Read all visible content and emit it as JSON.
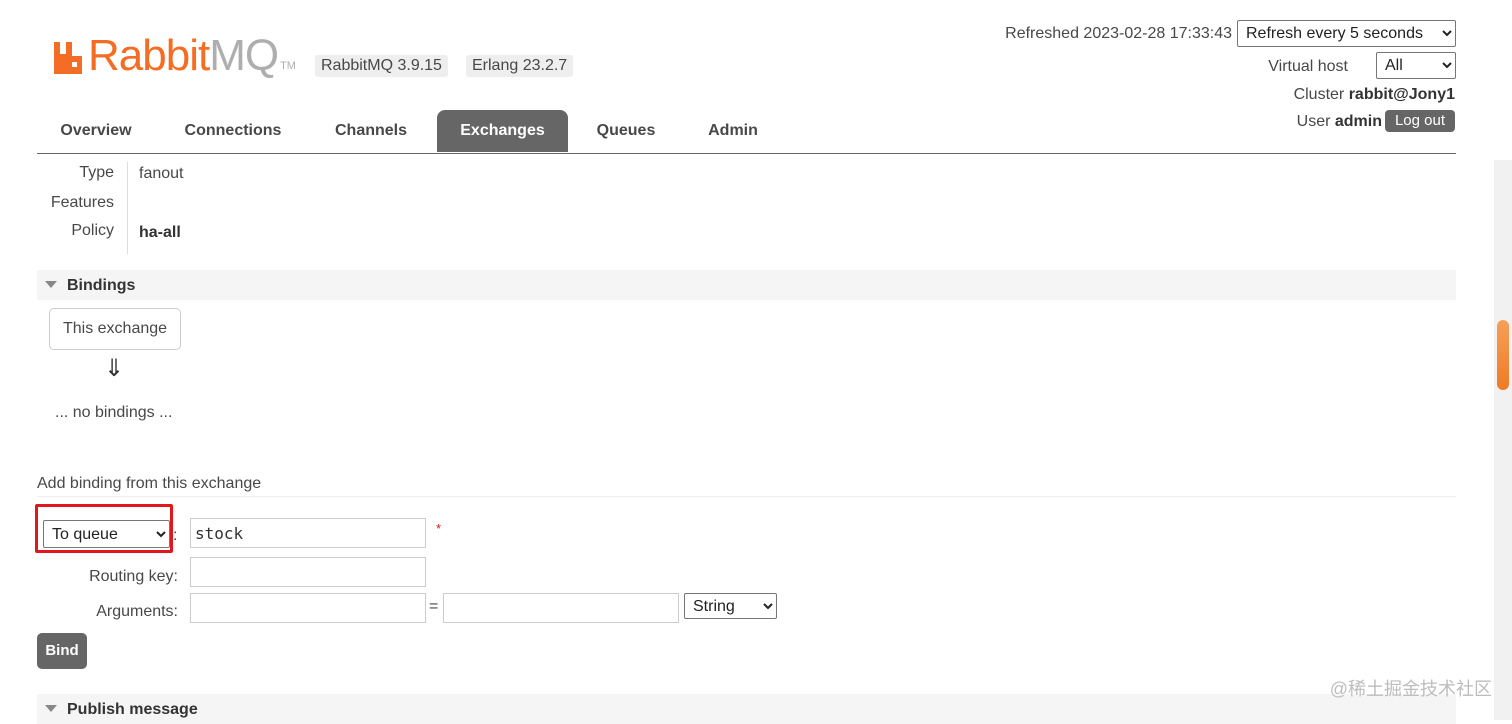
{
  "header": {
    "logo_rabbit": "Rabbit",
    "logo_mq": "MQ",
    "logo_tm": "TM",
    "rabbitmq_version": "RabbitMQ 3.9.15",
    "erlang_version": "Erlang 23.2.7",
    "refreshed_label": "Refreshed 2023-02-28 17:33:43",
    "refresh_select_value": "Refresh every 5 seconds",
    "virtual_host_label": "Virtual host",
    "virtual_host_value": "All",
    "cluster_label": "Cluster",
    "cluster_value": "rabbit@Jony1",
    "user_label": "User",
    "user_value": "admin",
    "logout_label": "Log out",
    "brand_color": "#f46d25"
  },
  "tabs": [
    {
      "label": "Overview",
      "active": false
    },
    {
      "label": "Connections",
      "active": false
    },
    {
      "label": "Channels",
      "active": false
    },
    {
      "label": "Exchanges",
      "active": true
    },
    {
      "label": "Queues",
      "active": false
    },
    {
      "label": "Admin",
      "active": false
    }
  ],
  "details": {
    "type_label": "Type",
    "type_value": "fanout",
    "features_label": "Features",
    "features_value": "",
    "policy_label": "Policy",
    "policy_value": "ha-all"
  },
  "bindings": {
    "section_title": "Bindings",
    "this_exchange": "This exchange",
    "arrow": "⇓",
    "no_bindings": "... no bindings ..."
  },
  "add_binding": {
    "title": "Add binding from this exchange",
    "destination_type": "To queue",
    "colon": ":",
    "destination_value": "stock",
    "required_mark": "*",
    "routing_key_label": "Routing key:",
    "routing_key_value": "",
    "arguments_label": "Arguments:",
    "argument_key": "",
    "equals": "=",
    "argument_value": "",
    "argument_type": "String",
    "bind_label": "Bind",
    "highlight_color": "#e0181e"
  },
  "publish": {
    "section_title": "Publish message"
  },
  "watermark": "@稀土掘金技术社区"
}
